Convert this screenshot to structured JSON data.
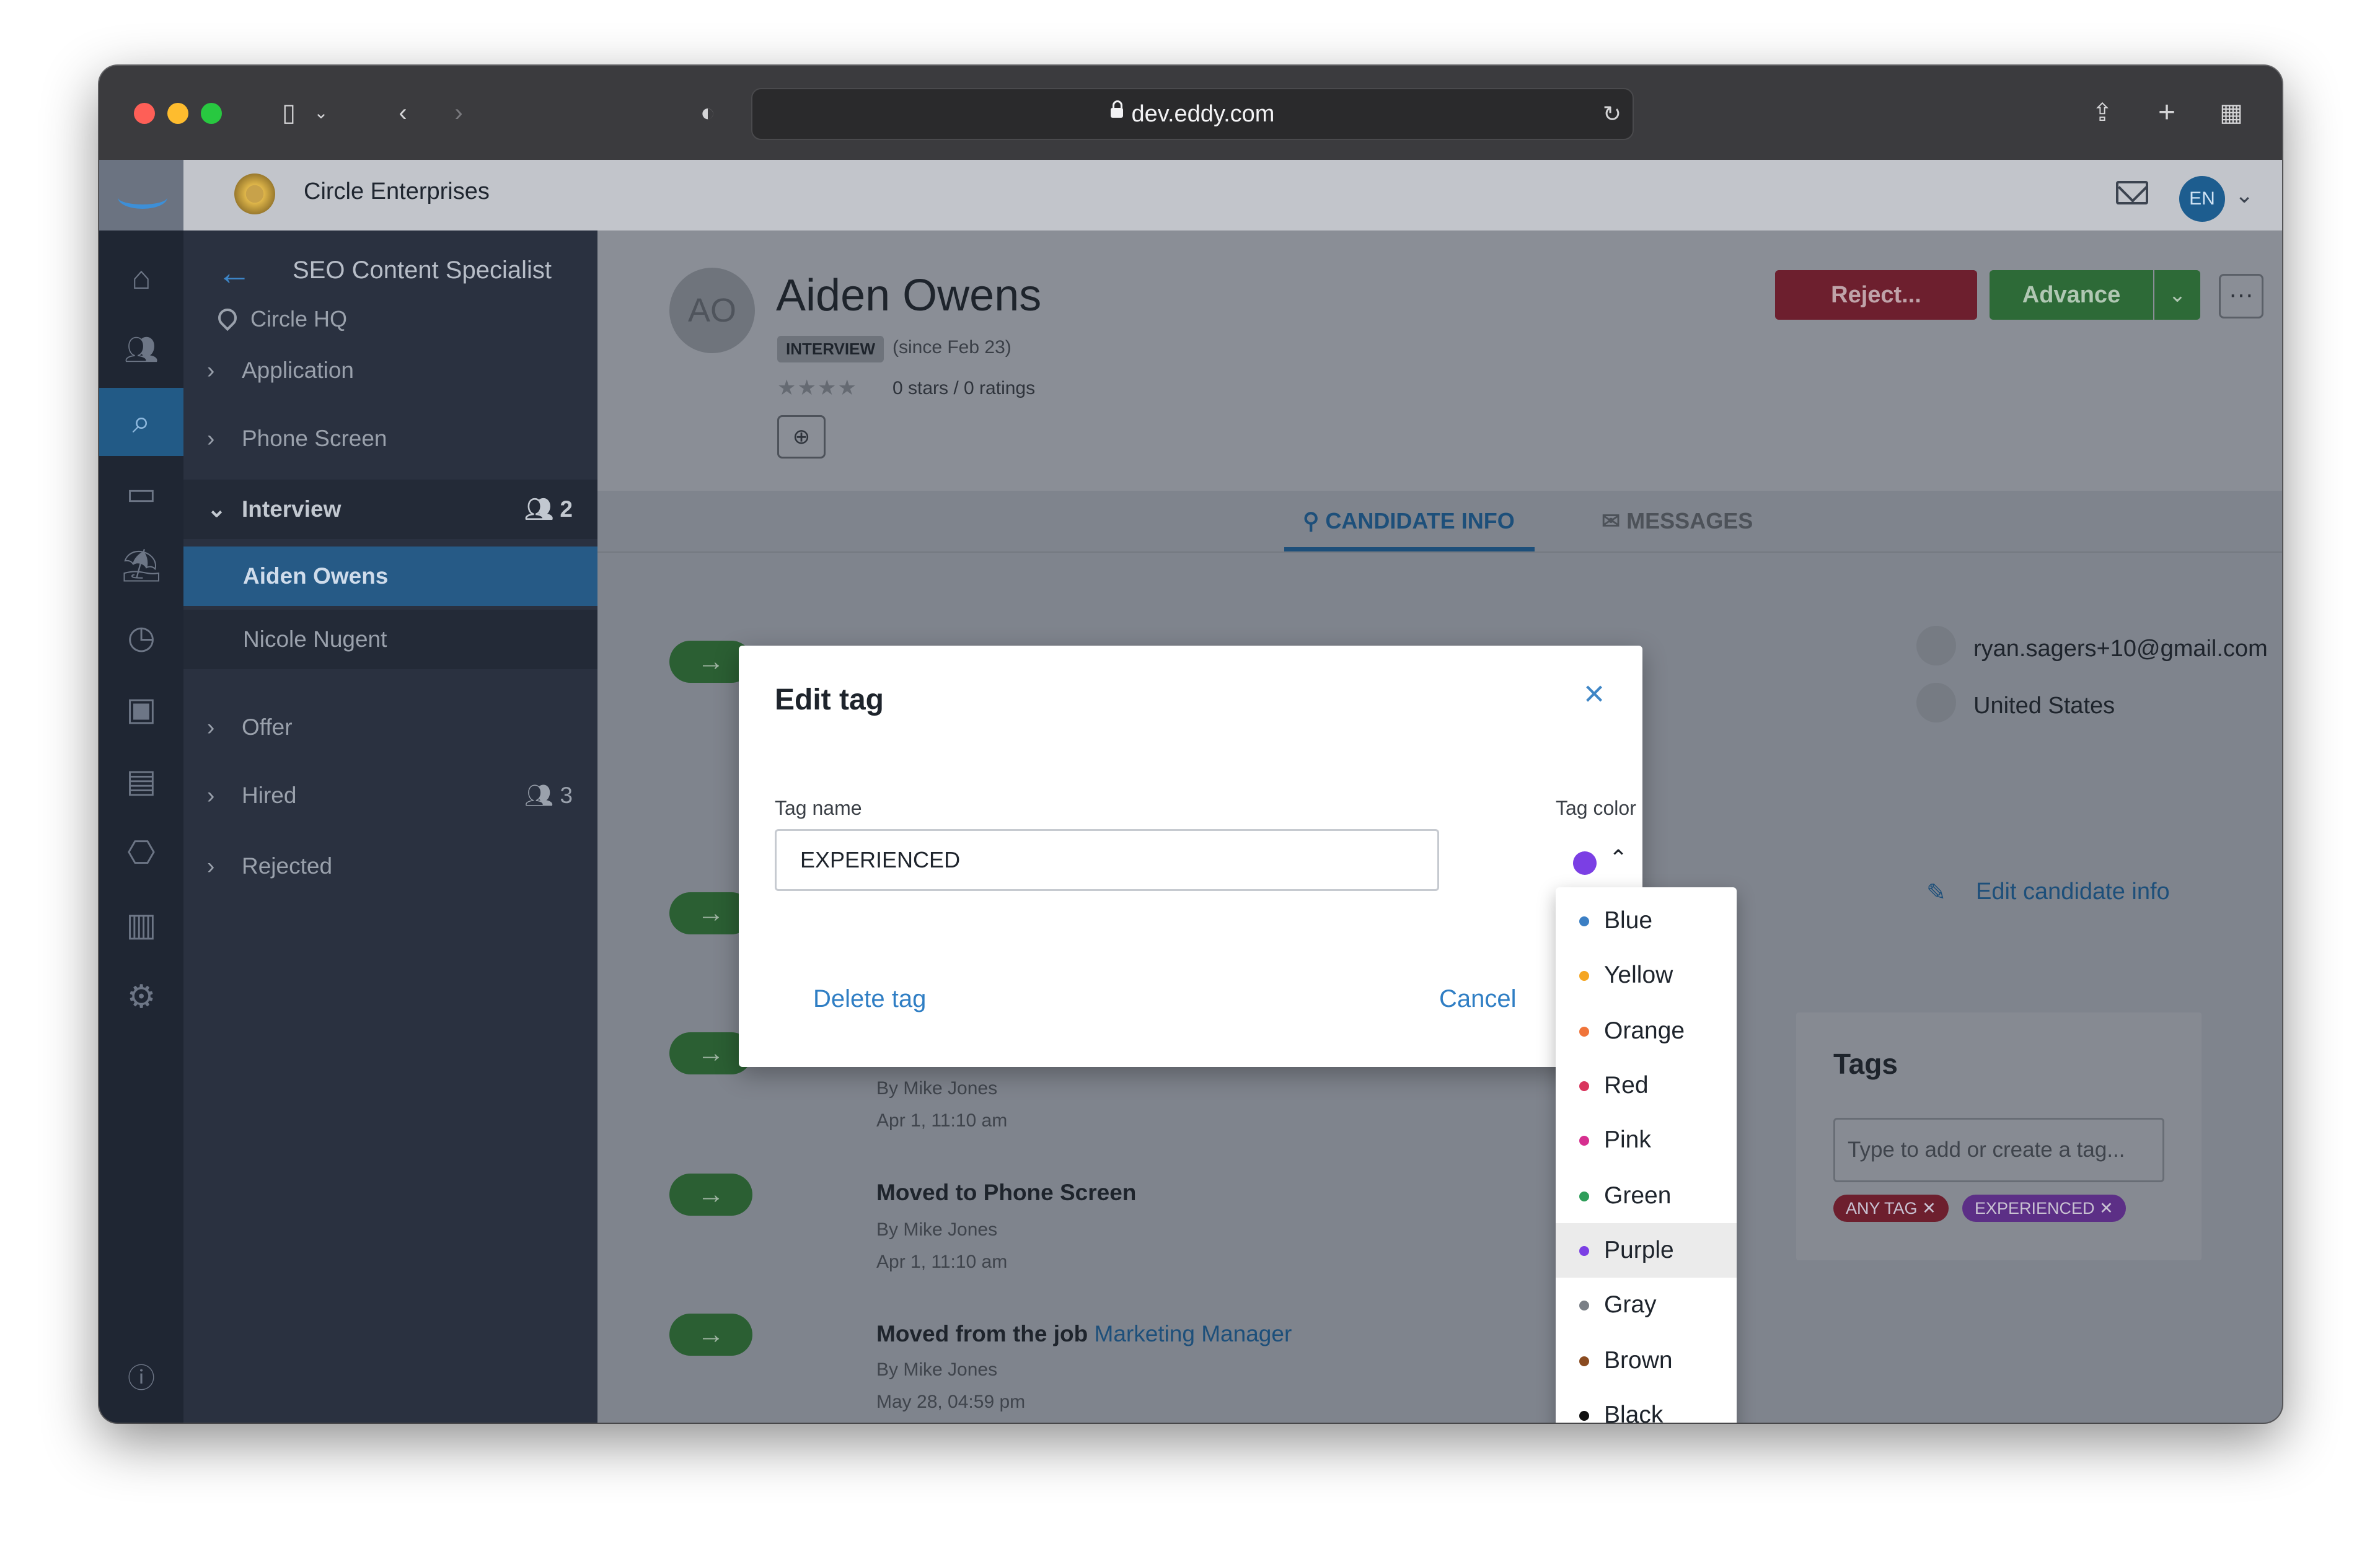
{
  "browser": {
    "url": "dev.eddy.com",
    "traffic_colors": [
      "#fe5f57",
      "#febc2e",
      "#28c840"
    ]
  },
  "header": {
    "company": "Circle Enterprises",
    "avatar_initials": "EN"
  },
  "rail_icons": [
    "home-icon",
    "people-icon",
    "candidates-search-icon",
    "clipboard-icon",
    "vacation-icon",
    "clock-icon",
    "money-icon",
    "documents-icon",
    "certificate-icon",
    "reports-chart-icon",
    "settings-gear-icon",
    "help-icon"
  ],
  "sidebar": {
    "job_title": "SEO Content Specialist",
    "location": "Circle HQ",
    "stages": [
      {
        "label": "Application"
      },
      {
        "label": "Phone Screen"
      },
      {
        "label": "Interview",
        "count": "2"
      },
      {
        "label": "Offer"
      },
      {
        "label": "Hired",
        "count": "3"
      },
      {
        "label": "Rejected"
      }
    ],
    "candidates": [
      "Aiden Owens",
      "Nicole Nugent"
    ]
  },
  "candidate": {
    "initials": "AO",
    "name": "Aiden Owens",
    "stage_badge": "INTERVIEW",
    "since": "(since Feb 23)",
    "rating_text": "0 stars / 0 ratings",
    "rating_stars": 0,
    "reject_label": "Reject...",
    "advance_label": "Advance"
  },
  "tabs": [
    "CANDIDATE INFO",
    "MESSAGES"
  ],
  "timeline": [
    {
      "by": "By Mike Jones",
      "time": "Apr 1, 11:10 am"
    },
    {
      "title": "Moved to Phone Screen",
      "by": "By Mike Jones",
      "time": "Apr 1, 11:10 am"
    },
    {
      "title": "Moved from the job ",
      "link": "Marketing Manager",
      "by": "By Mike Jones",
      "time": "May 28, 04:59 pm"
    }
  ],
  "contact": {
    "email": "ryan.sagers+10@gmail.com",
    "country": "United States",
    "edit_label": "Edit candidate info"
  },
  "tags_panel": {
    "title": "Tags",
    "placeholder": "Type to add or create a tag...",
    "chips": [
      {
        "label": "ANY TAG",
        "color": "#6d1f2e"
      },
      {
        "label": "EXPERIENCED",
        "color": "#5c2f86"
      }
    ]
  },
  "dialog": {
    "title": "Edit tag",
    "tag_name_label": "Tag name",
    "tag_name_value": "EXPERIENCED",
    "tag_color_label": "Tag color",
    "selected_color": "#7b3fe4",
    "delete_label": "Delete tag",
    "cancel_label": "Cancel"
  },
  "color_menu": {
    "selected": "Purple",
    "options": [
      {
        "label": "Blue",
        "color": "#3b7fc4"
      },
      {
        "label": "Yellow",
        "color": "#f5a623"
      },
      {
        "label": "Orange",
        "color": "#f0743a"
      },
      {
        "label": "Red",
        "color": "#d9365e"
      },
      {
        "label": "Pink",
        "color": "#d62f8f"
      },
      {
        "label": "Green",
        "color": "#2f9e5a"
      },
      {
        "label": "Purple",
        "color": "#7b3fe4"
      },
      {
        "label": "Gray",
        "color": "#7a7f86"
      },
      {
        "label": "Brown",
        "color": "#8a4b20"
      },
      {
        "label": "Black",
        "color": "#111111"
      }
    ]
  }
}
